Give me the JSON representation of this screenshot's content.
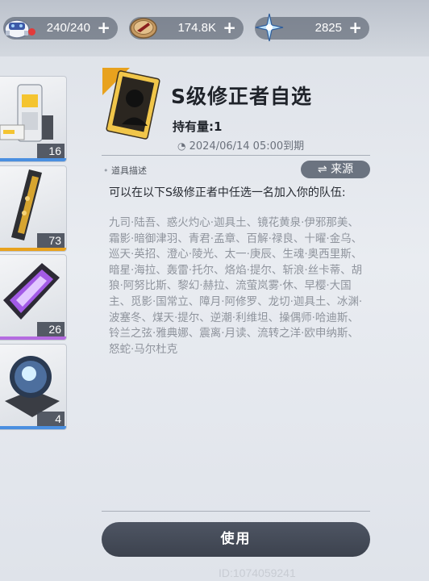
{
  "resources": [
    {
      "name": "stamina",
      "icon": "robot-stamina-icon",
      "value": "240/240"
    },
    {
      "name": "coin",
      "icon": "coin-icon",
      "value": "174.8K"
    },
    {
      "name": "crystal",
      "icon": "star-crystal-icon",
      "value": "2825"
    }
  ],
  "items": [
    {
      "icon": "gadget-box-icon",
      "count": "16",
      "rarity_color": "#4a8fe0"
    },
    {
      "icon": "gold-rail-icon",
      "count": "73",
      "rarity_color": "#e8a21e"
    },
    {
      "icon": "purple-core-icon",
      "count": "26",
      "rarity_color": "#b46be0"
    },
    {
      "icon": "energy-orb-icon",
      "count": "4",
      "rarity_color": "#4a8fe0"
    }
  ],
  "detail": {
    "title": "S级修正者自选",
    "owned": "持有量:1",
    "expire": "2024/06/14 05:00到期",
    "section_label": "道具描述",
    "source_button": "来源",
    "description": "可以在以下S级修正者中任选一名加入你的队伍:",
    "candidates": "九司·陆吾、惑火灼心·迦具土、镜花黄泉·伊邪那美、霜影·暗御津羽、青君·孟章、百解·禄良、十曜·金乌、巡天·英招、澄心·陵光、太一·庚辰、生魂·奥西里斯、暗星·海拉、轰雷·托尔、烙焰·提尔、斩浪·丝卡蒂、胡狼·阿努比斯、黎幻·赫拉、流萤岚雾·休、早樱·大国主、觅影·国常立、障月·阿修罗、龙切·迦具土、冰渊·波塞冬、煤天·提尔、逆潮·利维坦、操偶师·哈迪斯、铃兰之弦·雅典娜、震离·月读、流转之洋·欧申纳斯、怒蛇·马尔杜克",
    "use_button": "使用",
    "uid": "ID:1074059241"
  },
  "colors": {
    "accent_orange": "#e8a21e",
    "button_dark": "#454c59"
  }
}
